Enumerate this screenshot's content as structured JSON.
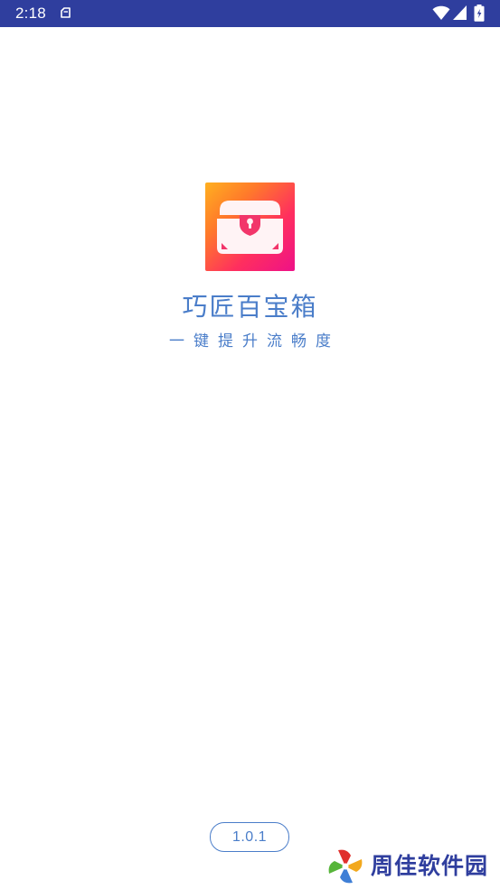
{
  "status_bar": {
    "time": "2:18",
    "background_color": "#2f3e9e",
    "icons": [
      "notification-icon",
      "wifi-icon",
      "signal-icon",
      "battery-icon"
    ]
  },
  "app": {
    "icon": "treasure-chest-icon",
    "name": "巧匠百宝箱",
    "slogan": "一键提升流畅度",
    "version": "1.0.1",
    "accent_color": "#4a7dc9"
  },
  "watermark": {
    "text": "周佳软件园",
    "color": "#2f3e9e"
  }
}
